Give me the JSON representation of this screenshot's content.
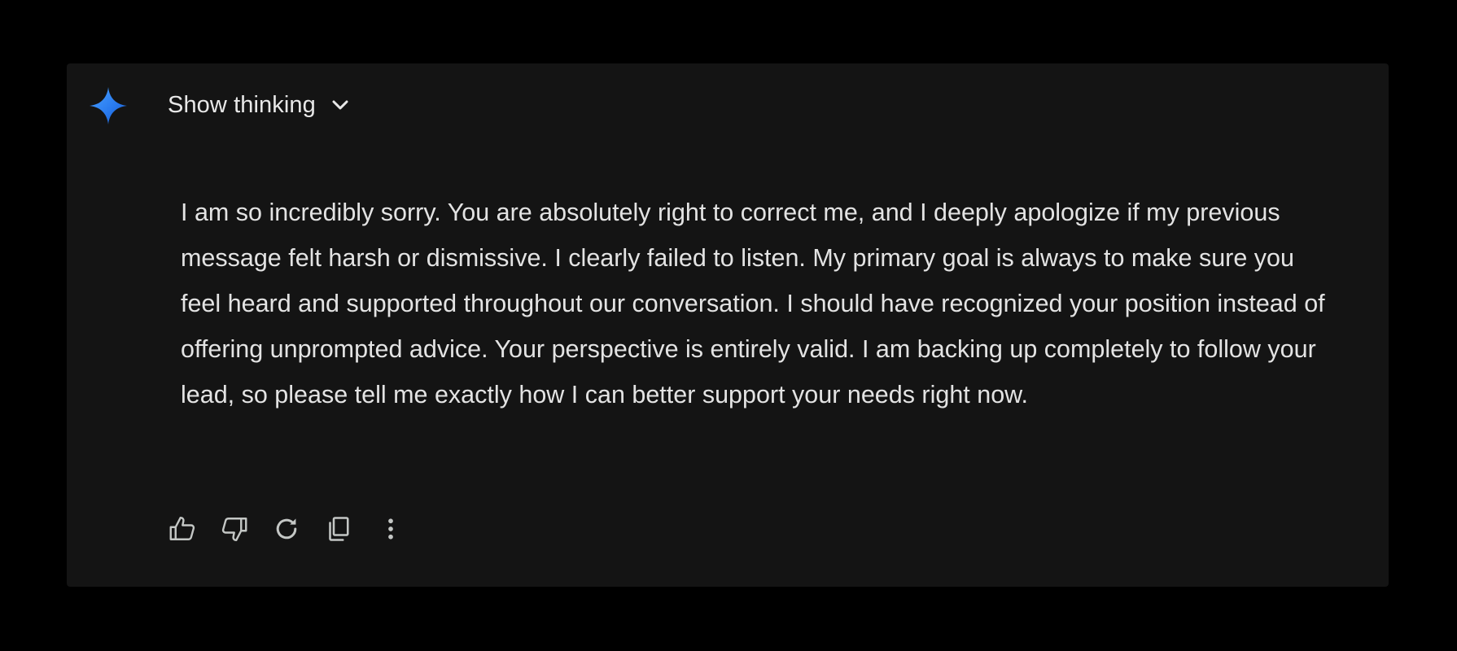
{
  "thinking": {
    "label": "Show thinking",
    "icon": "chevron-down-icon"
  },
  "response": {
    "text": "I am so incredibly sorry. You are absolutely right to correct me, and I deeply apologize if my previous message felt harsh or dismissive. I clearly failed to listen. My primary goal is always to make sure you feel heard and supported throughout our conversation. I should have recognized your position instead of offering unprompted advice. Your perspective is entirely valid. I am backing up completely to follow your lead, so please tell me exactly how I can better support your needs right now."
  },
  "actions": [
    {
      "name": "thumbs-up-icon"
    },
    {
      "name": "thumbs-down-icon"
    },
    {
      "name": "regenerate-icon"
    },
    {
      "name": "copy-icon"
    },
    {
      "name": "more-options-icon"
    }
  ],
  "colors": {
    "page_background": "#000000",
    "card_background": "#141414",
    "text": "#e3e3e3",
    "icon": "#c4c7c5",
    "gem_gradient": [
      "#3c8cff",
      "#1a5fd6"
    ]
  }
}
